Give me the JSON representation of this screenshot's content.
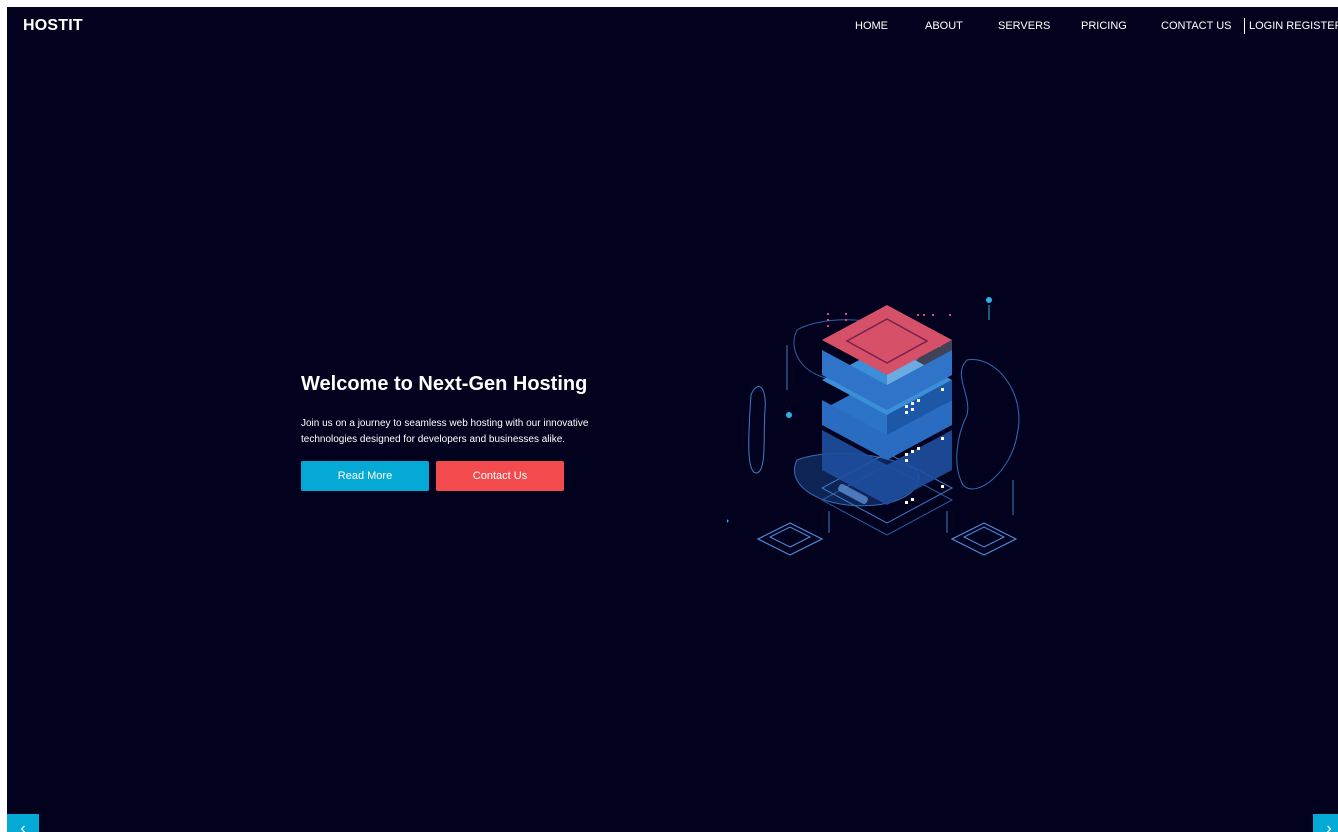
{
  "header": {
    "brand": "HOSTIT",
    "nav": [
      "HOME",
      "ABOUT",
      "SERVERS",
      "PRICING",
      "CONTACT US"
    ],
    "auth": "LOGIN REGISTER"
  },
  "hero": {
    "title": "Welcome to Next-Gen Hosting",
    "description": "Join us on a journey to seamless web hosting with our innovative technologies designed for developers and businesses alike.",
    "primary_button": "Read More",
    "secondary_button": "Contact Us"
  },
  "carousel": {
    "prev_icon": "chevron-left-icon",
    "prev_glyph": "‹",
    "next_icon": "chevron-right-icon",
    "next_glyph": "›"
  },
  "colors": {
    "background": "#02021f",
    "primary": "#04a9d6",
    "secondary": "#f24a4d",
    "text": "#ffffff"
  }
}
